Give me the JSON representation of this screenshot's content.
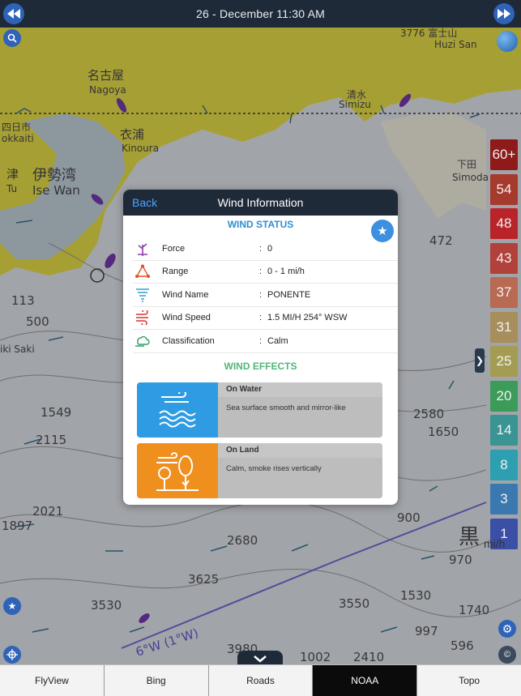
{
  "topbar": {
    "date": "26 - December  11:30 AM"
  },
  "map": {
    "labels": {
      "nagoya_jp": "名古屋",
      "nagoya": "Nagoya",
      "yokkaichi_jp": "四日市",
      "yokkaichi": "okkaiti",
      "kinoura_jp": "衣浦",
      "kinoura": "Kinoura",
      "isewan_jp": "伊勢湾",
      "isewan": "Ise Wan",
      "tsu_jp": "津",
      "tsu": "Tu",
      "shimizu_jp": "清水",
      "shimizu": "Simizu",
      "fuji": "3776 富士山",
      "fuji_en": "Huzi San",
      "shimoda": "下田",
      "shimoda_en": "Simoda",
      "daio": "iki Saki",
      "fathom_6w": "6°W (1°W)",
      "kuro_jp": "黒"
    },
    "depths": [
      "500",
      "113",
      "472",
      "1549",
      "2580",
      "1650",
      "2115",
      "2021",
      "1897",
      "900",
      "2680",
      "970",
      "3625",
      "1530",
      "3530",
      "3550",
      "1740",
      "997",
      "596",
      "3980",
      "2410",
      "1002"
    ]
  },
  "legend": {
    "unit": "mi/h",
    "cells": [
      {
        "label": "60+",
        "color": "#8e1a1a"
      },
      {
        "label": "54",
        "color": "#a63a2c"
      },
      {
        "label": "48",
        "color": "#b8242a"
      },
      {
        "label": "43",
        "color": "#b2413b"
      },
      {
        "label": "37",
        "color": "#b86a52"
      },
      {
        "label": "31",
        "color": "#a88e5c"
      },
      {
        "label": "25",
        "color": "#a59c54"
      },
      {
        "label": "20",
        "color": "#3b9b58"
      },
      {
        "label": "14",
        "color": "#3b9494"
      },
      {
        "label": "8",
        "color": "#2e9fb0"
      },
      {
        "label": "3",
        "color": "#3b78b0"
      },
      {
        "label": "1",
        "color": "#3c4fa6"
      }
    ]
  },
  "modal": {
    "back": "Back",
    "title": "Wind Information",
    "status_title": "WIND STATUS",
    "effects_title": "WIND EFFECTS",
    "rows": [
      {
        "label": "Force",
        "value": "0"
      },
      {
        "label": "Range",
        "value": "0 - 1  mi/h"
      },
      {
        "label": "Wind Name",
        "value": "PONENTE"
      },
      {
        "label": "Wind Speed",
        "value": "1.5 MI/H 254° WSW"
      },
      {
        "label": "Classification",
        "value": "Calm"
      }
    ],
    "effects": {
      "water": {
        "title": "On Water",
        "desc": "Sea surface smooth and mirror-like",
        "color": "#2f9be3"
      },
      "land": {
        "title": "On Land",
        "desc": "Calm, smoke rises vertically",
        "color": "#ef8f1e"
      }
    }
  },
  "bottombar": {
    "tabs": [
      "FlyView",
      "Bing",
      "Roads",
      "NOAA",
      "Topo"
    ],
    "active": "NOAA"
  }
}
